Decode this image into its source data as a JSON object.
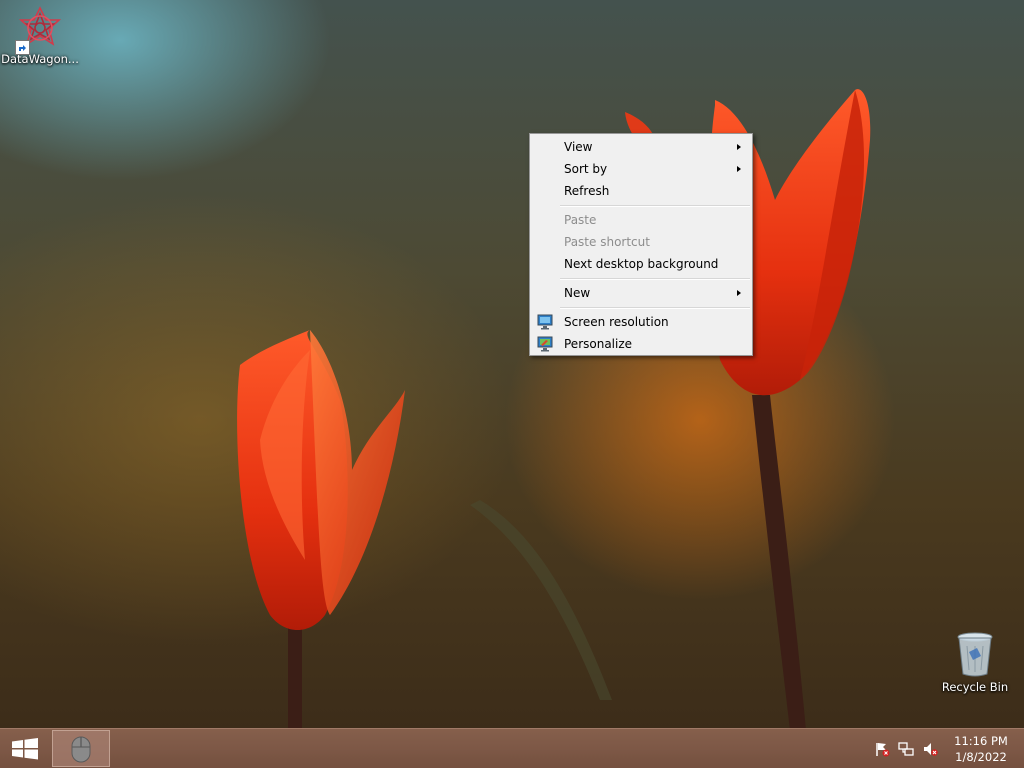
{
  "desktop": {
    "icons": [
      {
        "label": "DataWagon...",
        "icon": "datawagon-logo-icon"
      },
      {
        "label": "Recycle Bin",
        "icon": "recycle-bin-icon"
      }
    ]
  },
  "context_menu": {
    "items": [
      {
        "label": "View",
        "submenu": true,
        "disabled": false
      },
      {
        "label": "Sort by",
        "submenu": true,
        "disabled": false
      },
      {
        "label": "Refresh",
        "submenu": false,
        "disabled": false
      },
      {
        "label": "Paste",
        "submenu": false,
        "disabled": true
      },
      {
        "label": "Paste shortcut",
        "submenu": false,
        "disabled": true
      },
      {
        "label": "Next desktop background",
        "submenu": false,
        "disabled": false
      },
      {
        "label": "New",
        "submenu": true,
        "disabled": false
      },
      {
        "label": "Screen resolution",
        "submenu": false,
        "disabled": false,
        "icon": "screen-resolution-icon"
      },
      {
        "label": "Personalize",
        "submenu": false,
        "disabled": false,
        "icon": "personalize-icon"
      }
    ]
  },
  "taskbar": {
    "start_icon": "windows-logo-icon",
    "pinned_app_icon": "mouse-icon",
    "tray": {
      "icons": [
        "action-center-flag-icon",
        "network-icon",
        "volume-muted-icon"
      ],
      "time": "11:16 PM",
      "date": "1/8/2022"
    }
  },
  "colors": {
    "menu_background": "#f0f0f0",
    "menu_disabled_text": "#8d8d8d",
    "taskbar": "#8c6450"
  }
}
